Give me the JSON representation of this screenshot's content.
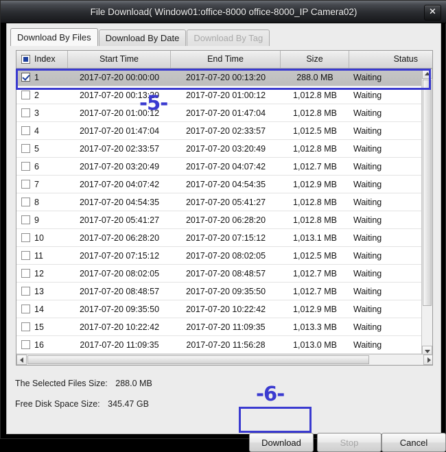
{
  "window": {
    "title": "File Download( Window01:office-8000 office-8000_IP Camera02)",
    "close_icon": "close-icon",
    "close_glyph": "✕"
  },
  "tabs": [
    {
      "label": "Download By Files",
      "state": "active"
    },
    {
      "label": "Download By Date",
      "state": "inactive"
    },
    {
      "label": "Download By Tag",
      "state": "disabled"
    }
  ],
  "table": {
    "columns": [
      "Index",
      "Start Time",
      "End Time",
      "Size",
      "Status"
    ],
    "header_checkbox_state": "partial",
    "rows": [
      {
        "index": "1",
        "start": "2017-07-20 00:00:00",
        "end": "2017-07-20 00:13:20",
        "size": "288.0 MB",
        "status": "Waiting",
        "checked": true,
        "selected": true
      },
      {
        "index": "2",
        "start": "2017-07-20 00:13:20",
        "end": "2017-07-20 01:00:12",
        "size": "1,012.8 MB",
        "status": "Waiting",
        "checked": false,
        "selected": false
      },
      {
        "index": "3",
        "start": "2017-07-20 01:00:12",
        "end": "2017-07-20 01:47:04",
        "size": "1,012.8 MB",
        "status": "Waiting",
        "checked": false,
        "selected": false
      },
      {
        "index": "4",
        "start": "2017-07-20 01:47:04",
        "end": "2017-07-20 02:33:57",
        "size": "1,012.5 MB",
        "status": "Waiting",
        "checked": false,
        "selected": false
      },
      {
        "index": "5",
        "start": "2017-07-20 02:33:57",
        "end": "2017-07-20 03:20:49",
        "size": "1,012.8 MB",
        "status": "Waiting",
        "checked": false,
        "selected": false
      },
      {
        "index": "6",
        "start": "2017-07-20 03:20:49",
        "end": "2017-07-20 04:07:42",
        "size": "1,012.7 MB",
        "status": "Waiting",
        "checked": false,
        "selected": false
      },
      {
        "index": "7",
        "start": "2017-07-20 04:07:42",
        "end": "2017-07-20 04:54:35",
        "size": "1,012.9 MB",
        "status": "Waiting",
        "checked": false,
        "selected": false
      },
      {
        "index": "8",
        "start": "2017-07-20 04:54:35",
        "end": "2017-07-20 05:41:27",
        "size": "1,012.8 MB",
        "status": "Waiting",
        "checked": false,
        "selected": false
      },
      {
        "index": "9",
        "start": "2017-07-20 05:41:27",
        "end": "2017-07-20 06:28:20",
        "size": "1,012.8 MB",
        "status": "Waiting",
        "checked": false,
        "selected": false
      },
      {
        "index": "10",
        "start": "2017-07-20 06:28:20",
        "end": "2017-07-20 07:15:12",
        "size": "1,013.1 MB",
        "status": "Waiting",
        "checked": false,
        "selected": false
      },
      {
        "index": "11",
        "start": "2017-07-20 07:15:12",
        "end": "2017-07-20 08:02:05",
        "size": "1,012.5 MB",
        "status": "Waiting",
        "checked": false,
        "selected": false
      },
      {
        "index": "12",
        "start": "2017-07-20 08:02:05",
        "end": "2017-07-20 08:48:57",
        "size": "1,012.7 MB",
        "status": "Waiting",
        "checked": false,
        "selected": false
      },
      {
        "index": "13",
        "start": "2017-07-20 08:48:57",
        "end": "2017-07-20 09:35:50",
        "size": "1,012.7 MB",
        "status": "Waiting",
        "checked": false,
        "selected": false
      },
      {
        "index": "14",
        "start": "2017-07-20 09:35:50",
        "end": "2017-07-20 10:22:42",
        "size": "1,012.9 MB",
        "status": "Waiting",
        "checked": false,
        "selected": false
      },
      {
        "index": "15",
        "start": "2017-07-20 10:22:42",
        "end": "2017-07-20 11:09:35",
        "size": "1,013.3 MB",
        "status": "Waiting",
        "checked": false,
        "selected": false
      },
      {
        "index": "16",
        "start": "2017-07-20 11:09:35",
        "end": "2017-07-20 11:56:28",
        "size": "1,013.0 MB",
        "status": "Waiting",
        "checked": false,
        "selected": false
      }
    ]
  },
  "info": {
    "selected_label": "The Selected Files Size:",
    "selected_value": "288.0 MB",
    "free_label": "Free Disk Space Size:",
    "free_value": "345.47 GB"
  },
  "buttons": {
    "download": "Download",
    "stop": "Stop",
    "cancel": "Cancel"
  },
  "annotations": {
    "step5": "-5-",
    "step6": "-6-",
    "color": "#3a3ad0"
  },
  "scrollbars": {
    "vertical_up_icon": "triangle-up-icon",
    "vertical_down_icon": "triangle-down-icon",
    "horizontal_left_icon": "triangle-left-icon",
    "horizontal_right_icon": "triangle-right-icon"
  }
}
